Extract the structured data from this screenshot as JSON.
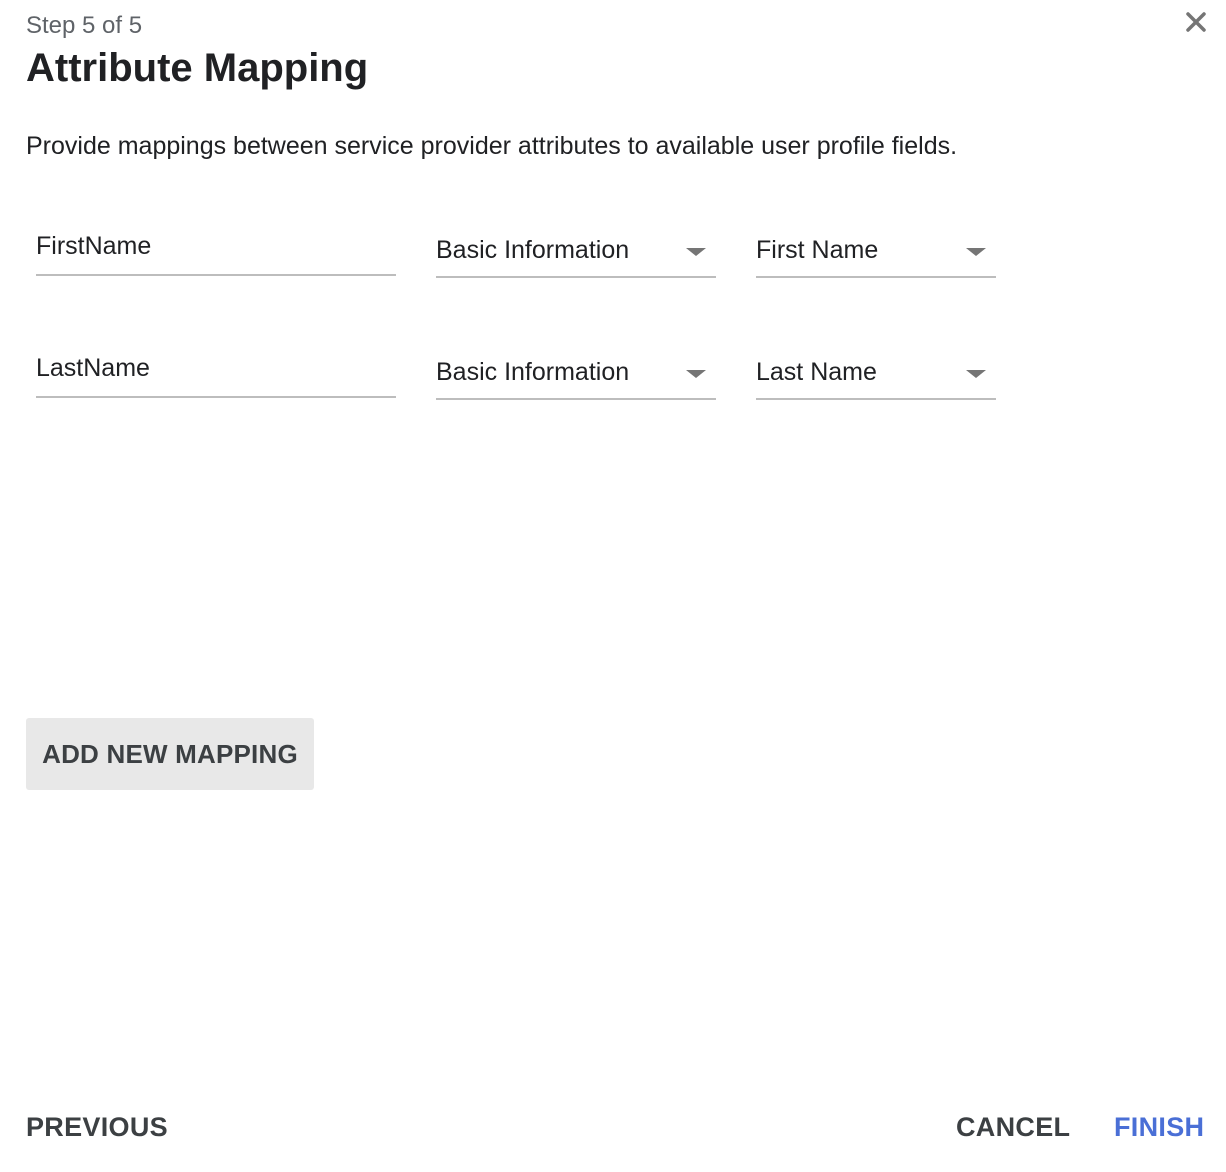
{
  "dialog": {
    "step": "Step 5 of 5",
    "title": "Attribute Mapping",
    "description": "Provide mappings between service provider attributes to available user profile fields.",
    "close_icon": "close-icon"
  },
  "mappings": [
    {
      "attribute": "FirstName",
      "category": "Basic Information",
      "field": "First Name"
    },
    {
      "attribute": "LastName",
      "category": "Basic Information",
      "field": "Last Name"
    }
  ],
  "actions": {
    "add_mapping": "ADD NEW MAPPING",
    "previous": "PREVIOUS",
    "cancel": "CANCEL",
    "finish": "FINISH"
  },
  "colors": {
    "accent": "#4a6fd6",
    "button_bg": "#e8e8e8",
    "underline": "#bdbdbd"
  }
}
